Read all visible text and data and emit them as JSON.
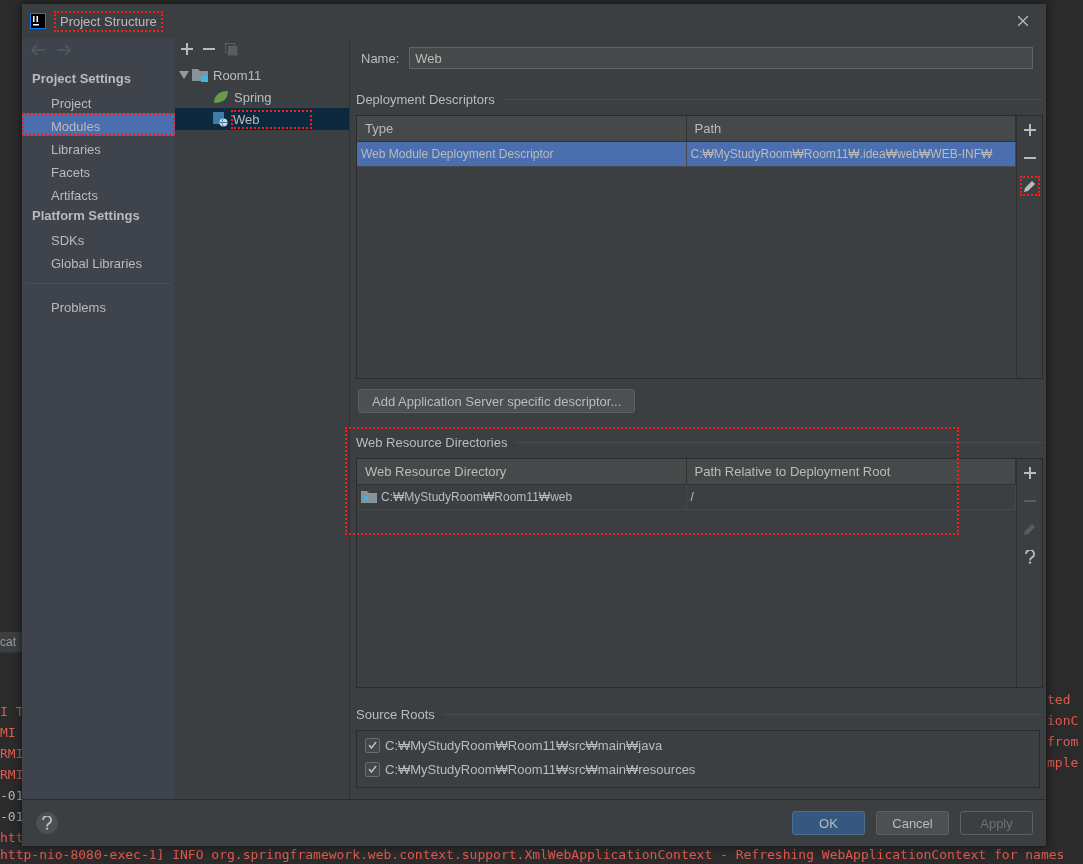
{
  "background_console": {
    "tab_label": "cat",
    "left_lines": [
      {
        "text": "I T",
        "kind": "error"
      },
      {
        "text": "MI",
        "kind": "error"
      },
      {
        "text": "RMI",
        "kind": "error"
      },
      {
        "text": "RMI",
        "kind": "error"
      },
      {
        "text": "-01",
        "kind": "info"
      },
      {
        "text": "-01",
        "kind": "info"
      },
      {
        "text": "htt",
        "kind": "error"
      }
    ],
    "right_lines": [
      {
        "text": "ted",
        "kind": "error"
      },
      {
        "text": "ionC",
        "kind": "error"
      },
      {
        "text": "from",
        "kind": "error"
      },
      {
        "text": "mple",
        "kind": "error"
      }
    ],
    "bottom_line": {
      "text": "http-nio-8080-exec-1] INFO org.springframework.web.context.support.XmlWebApplicationContext - Refreshing WebApplicationContext for names",
      "kind": "error"
    }
  },
  "window": {
    "title": "Project Structure",
    "highlighted": true
  },
  "sidebar": {
    "groups": [
      {
        "heading": "Project Settings",
        "items": [
          {
            "label": "Project",
            "selected": false,
            "highlighted": false
          },
          {
            "label": "Modules",
            "selected": true,
            "highlighted": true
          },
          {
            "label": "Libraries",
            "selected": false,
            "highlighted": false
          },
          {
            "label": "Facets",
            "selected": false,
            "highlighted": false
          },
          {
            "label": "Artifacts",
            "selected": false,
            "highlighted": false
          }
        ]
      },
      {
        "heading": "Platform Settings",
        "items": [
          {
            "label": "SDKs",
            "selected": false,
            "highlighted": false
          },
          {
            "label": "Global Libraries",
            "selected": false,
            "highlighted": false
          }
        ]
      }
    ],
    "bottom_items": [
      {
        "label": "Problems",
        "selected": false,
        "highlighted": false
      }
    ]
  },
  "tree": {
    "items": [
      {
        "label": "Room11",
        "kind": "module",
        "expanded": true,
        "selected": false,
        "highlighted": false,
        "children": [
          {
            "label": "Spring",
            "kind": "spring",
            "selected": false,
            "highlighted": false
          },
          {
            "label": "Web",
            "kind": "web",
            "selected": true,
            "highlighted": true
          }
        ]
      }
    ]
  },
  "name_field": {
    "label": "Name:",
    "value": "Web"
  },
  "deployment_descriptors": {
    "title": "Deployment Descriptors",
    "columns": [
      "Type",
      "Path"
    ],
    "rows": [
      {
        "cells": [
          "Web Module Deployment Descriptor",
          "C:₩MyStudyRoom₩Room11₩.idea₩web₩WEB-INF₩"
        ],
        "selected": true
      }
    ],
    "tools": [
      {
        "kind": "add",
        "disabled": false,
        "highlighted": false
      },
      {
        "kind": "remove",
        "disabled": false,
        "highlighted": false
      },
      {
        "kind": "edit",
        "disabled": false,
        "highlighted": true
      }
    ]
  },
  "add_descriptor_button": {
    "label": "Add Application Server specific descriptor..."
  },
  "web_resource_directories": {
    "title": "Web Resource Directories",
    "highlighted": true,
    "columns": [
      "Web Resource Directory",
      "Path Relative to Deployment Root"
    ],
    "rows": [
      {
        "cells": [
          "C:₩MyStudyRoom₩Room11₩web",
          "/"
        ],
        "selected": false
      }
    ],
    "tools": [
      {
        "kind": "add",
        "disabled": false,
        "highlighted": false
      },
      {
        "kind": "remove",
        "disabled": true,
        "highlighted": false
      },
      {
        "kind": "edit",
        "disabled": true,
        "highlighted": false
      },
      {
        "kind": "help",
        "disabled": false,
        "highlighted": false
      }
    ]
  },
  "source_roots": {
    "title": "Source Roots",
    "items": [
      {
        "label": "C:₩MyStudyRoom₩Room11₩src₩main₩java",
        "checked": true
      },
      {
        "label": "C:₩MyStudyRoom₩Room11₩src₩main₩resources",
        "checked": true
      }
    ]
  },
  "buttons": [
    {
      "label": "OK",
      "kind": "primary",
      "disabled": false
    },
    {
      "label": "Cancel",
      "kind": "normal",
      "disabled": false
    },
    {
      "label": "Apply",
      "kind": "normal",
      "disabled": true
    }
  ]
}
